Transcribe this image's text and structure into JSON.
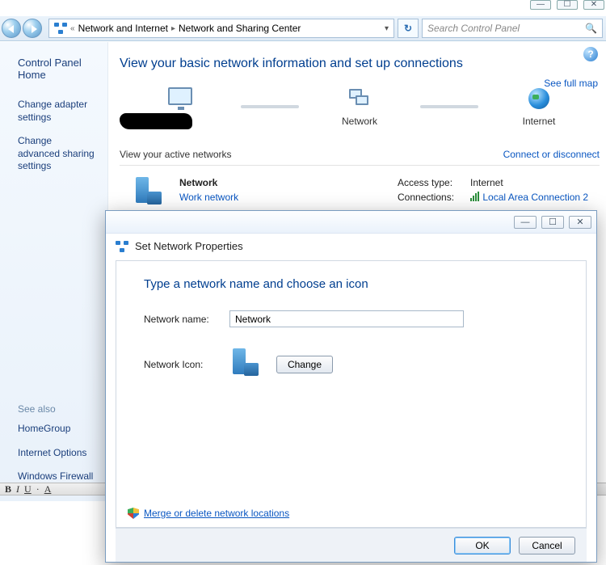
{
  "window_controls": {
    "min": "—",
    "max": "☐",
    "close": "✕"
  },
  "breadcrumb": {
    "chevrons": "«",
    "part1": "Network and Internet",
    "sep": "▸",
    "part2": "Network and Sharing Center",
    "dropdown": "▾"
  },
  "refresh_glyph": "↻",
  "search": {
    "placeholder": "Search Control Panel",
    "mag": "🔍"
  },
  "sidebar": {
    "home": "Control Panel Home",
    "links": [
      "Change adapter settings",
      "Change advanced sharing settings"
    ],
    "see_also_heading": "See also",
    "see_also": [
      "HomeGroup",
      "Internet Options",
      "Windows Firewall"
    ]
  },
  "content": {
    "heading": "View your basic network information and set up connections",
    "see_full_map": "See full map",
    "nodes": {
      "network": "Network",
      "internet": "Internet"
    },
    "view_active": "View your active networks",
    "connect_or_disconnect": "Connect or disconnect",
    "card": {
      "name": "Network",
      "type": "Work network",
      "access_label": "Access type:",
      "access_value": "Internet",
      "connections_label": "Connections:",
      "connections_value": "Local Area Connection 2"
    }
  },
  "dialog": {
    "title": "Set Network Properties",
    "heading": "Type a network name and choose an icon",
    "name_label": "Network name:",
    "name_value": "Network",
    "icon_label": "Network Icon:",
    "change": "Change",
    "merge": "Merge or delete network locations",
    "ok": "OK",
    "cancel": "Cancel",
    "ctrls": {
      "min": "—",
      "max": "☐",
      "close": "✕"
    }
  },
  "help_glyph": "?"
}
